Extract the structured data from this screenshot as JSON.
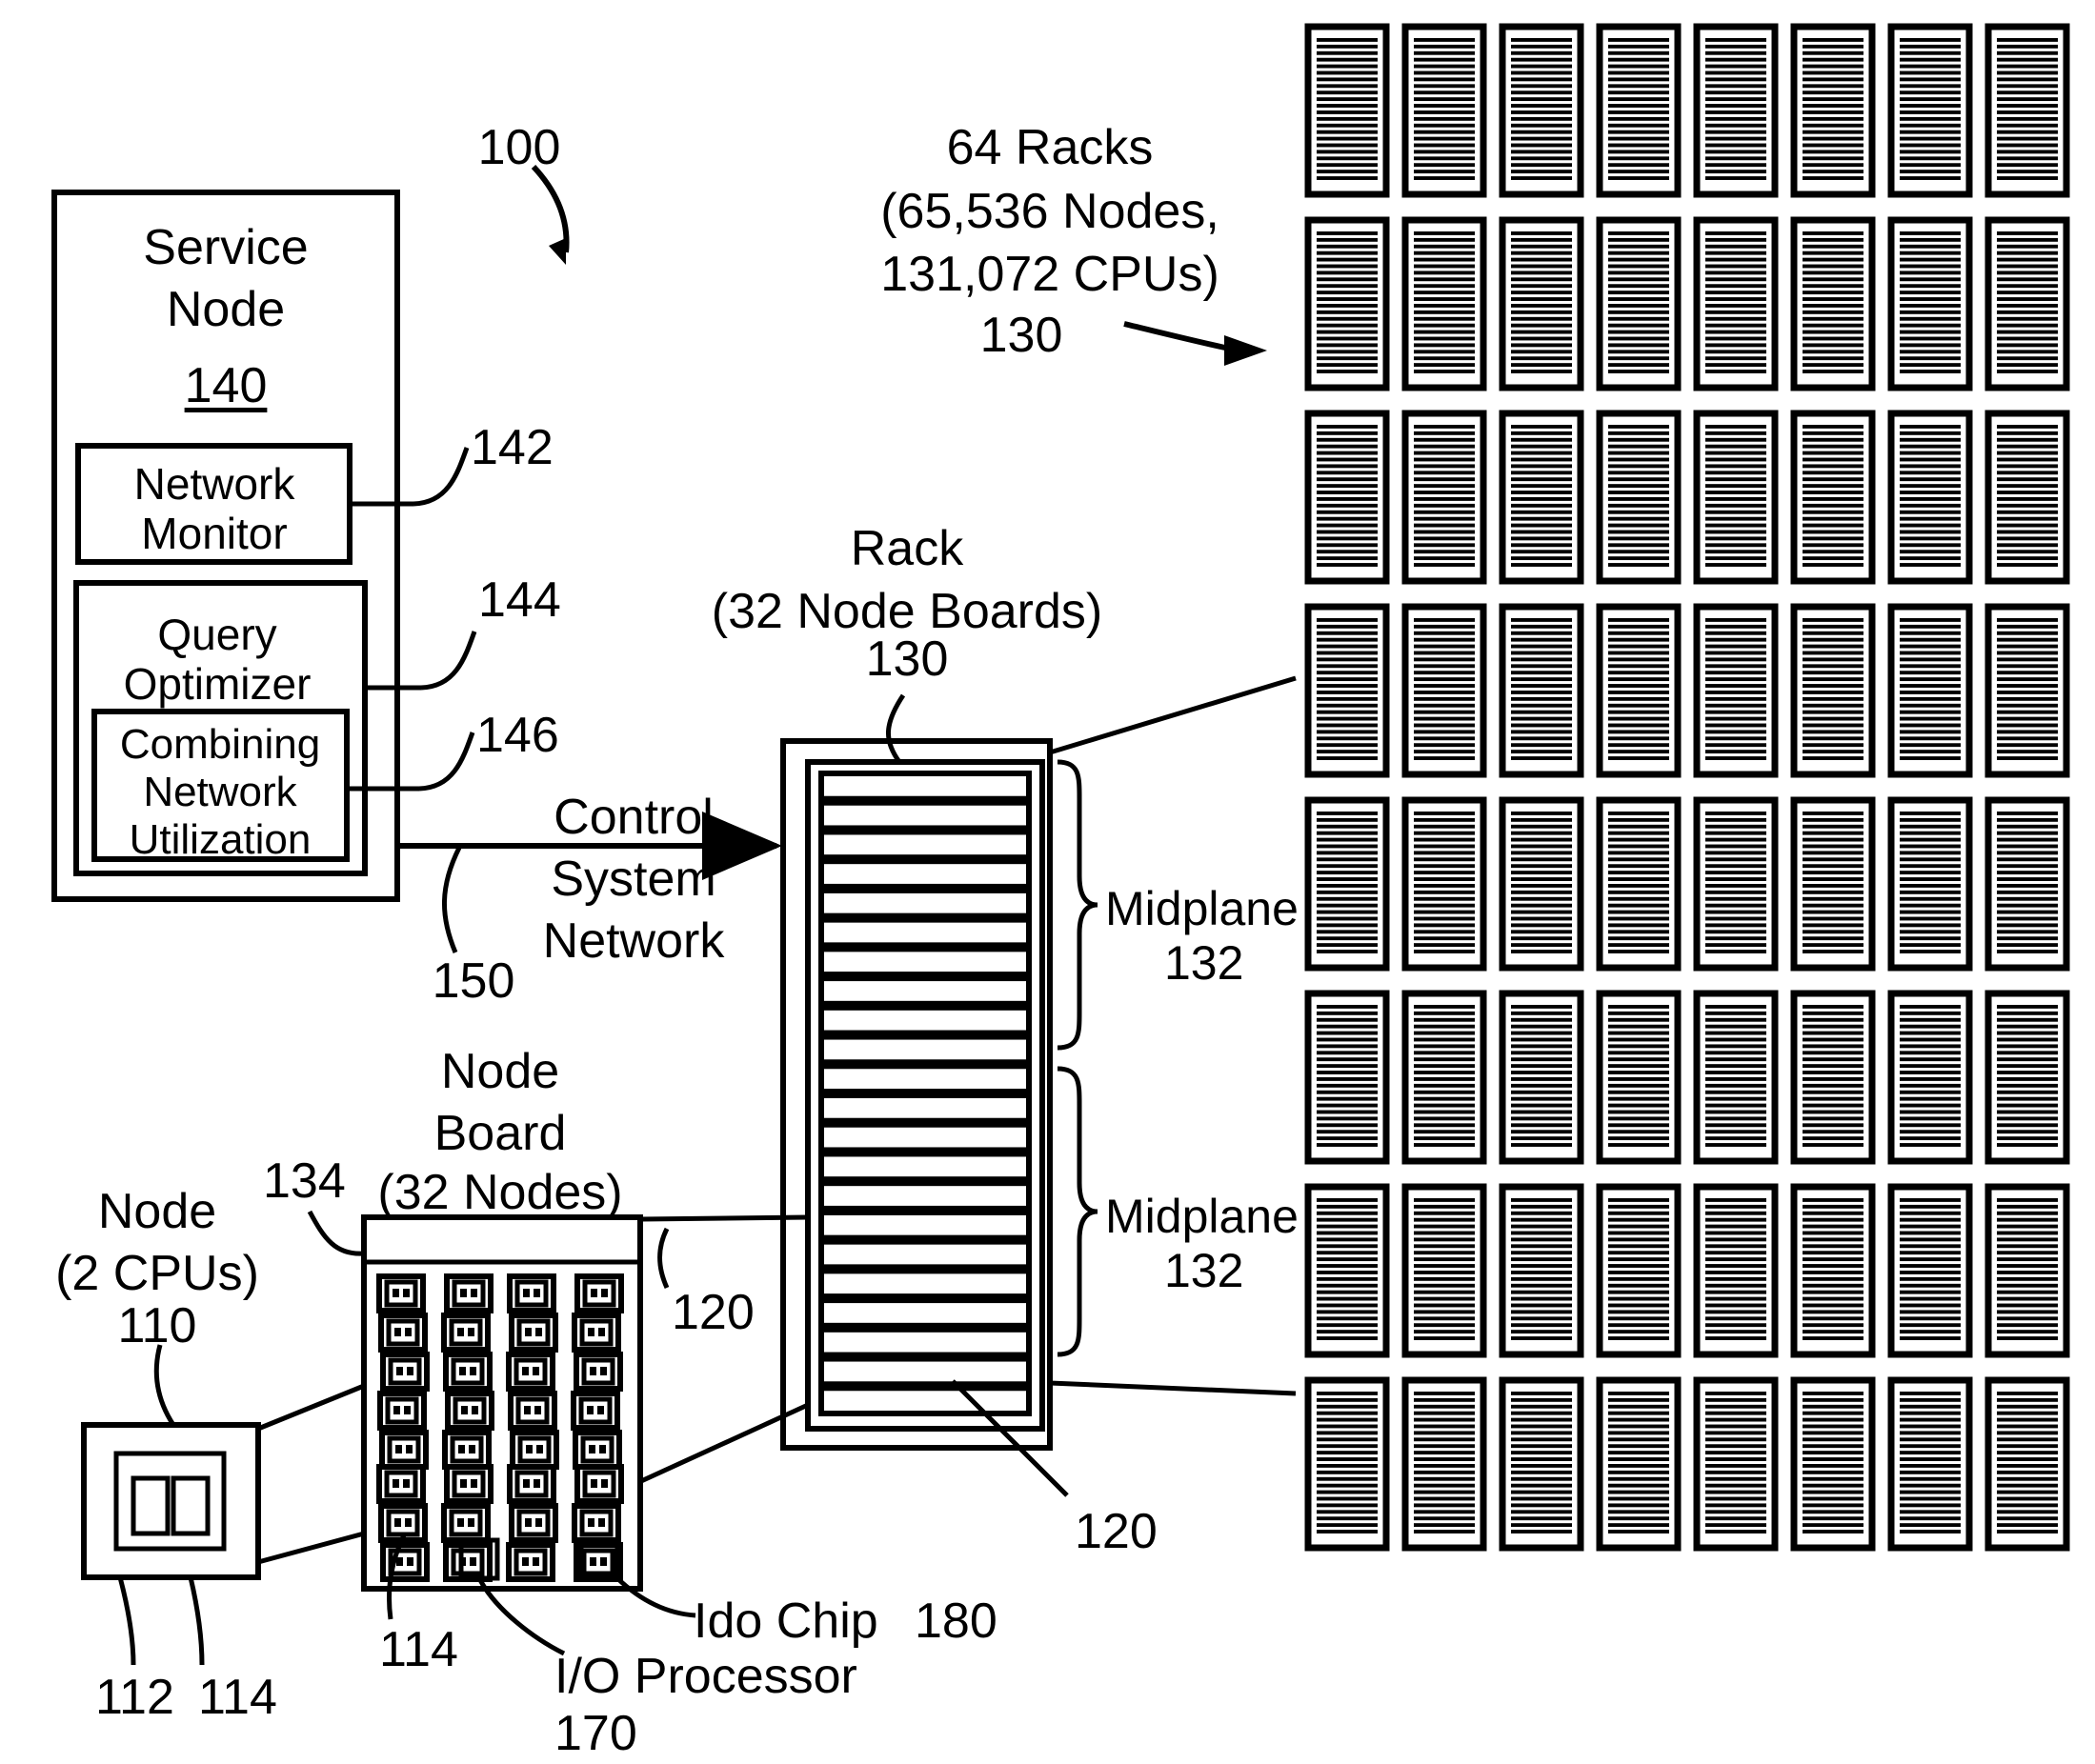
{
  "figure": {
    "figure_ref": "100",
    "service_node": {
      "title_line1": "Service",
      "title_line2": "Node",
      "ref": "140",
      "network_monitor": {
        "line1": "Network",
        "line2": "Monitor",
        "ref": "142"
      },
      "query_optimizer": {
        "line1": "Query",
        "line2": "Optimizer",
        "ref": "144"
      },
      "combining_network_utilization": {
        "line1": "Combining",
        "line2": "Network",
        "line3": "Utilization",
        "ref": "146"
      }
    },
    "control_system_network": {
      "line1": "Control",
      "line2": "System",
      "line3": "Network",
      "ref": "150"
    },
    "racks_cluster": {
      "line1": "64 Racks",
      "line2": "(65,536 Nodes,",
      "line3": "131,072 CPUs)",
      "ref": "130",
      "rows": 8,
      "columns": 8,
      "slats_per_rack": 22
    },
    "rack": {
      "line1": "Rack",
      "line2": "(32 Node Boards)",
      "ref": "130",
      "node_board_slots": 22,
      "node_board_ref_top": "120",
      "node_board_ref_bottom": "120",
      "midplane_upper": {
        "label": "Midplane",
        "ref": "132"
      },
      "midplane_lower": {
        "label": "Midplane",
        "ref": "132"
      }
    },
    "node_board": {
      "line1": "Node",
      "line2": "Board",
      "line3": "(32 Nodes)",
      "ref": "134",
      "node_ref": "114",
      "node_grid_rows": 8,
      "node_grid_cols": 4,
      "io_processor": {
        "label": "I/O Processor",
        "ref": "170"
      },
      "ido_chip": {
        "label": "Ido Chip",
        "ref": "180"
      }
    },
    "node": {
      "line1": "Node",
      "line2": "(2 CPUs)",
      "ref": "110",
      "cpu_ref": "112",
      "node_ref": "114",
      "cpu_count": 2
    },
    "colors": {
      "stroke": "#000000",
      "background": "#ffffff"
    }
  }
}
